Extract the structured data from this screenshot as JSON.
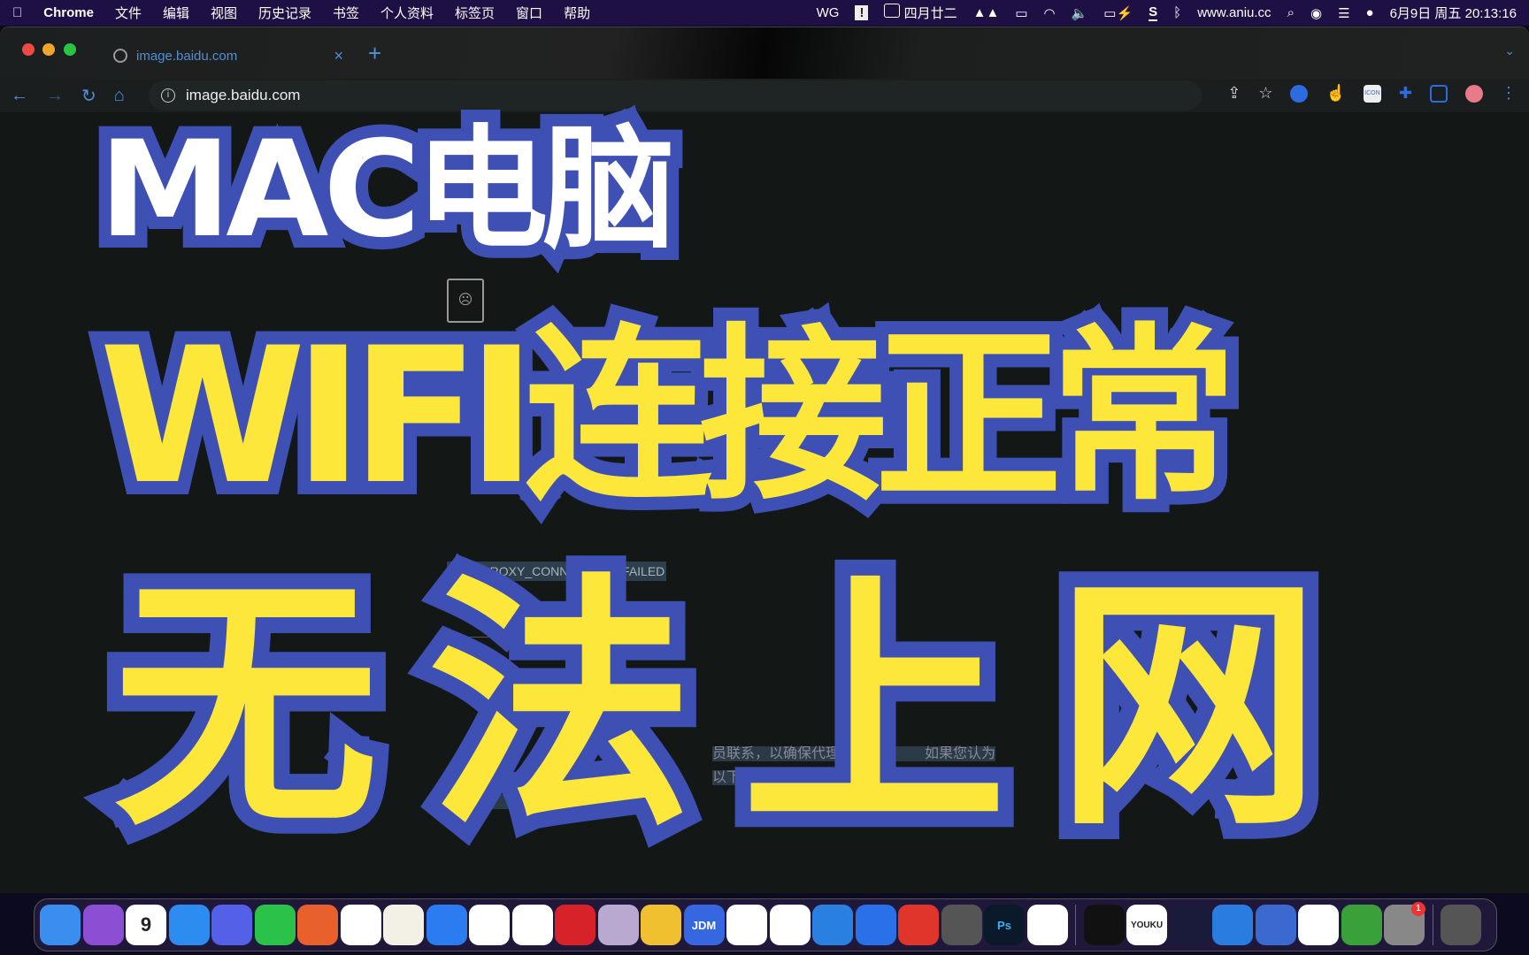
{
  "menubar": {
    "app": "Chrome",
    "items": [
      "文件",
      "编辑",
      "视图",
      "历史记录",
      "书签",
      "个人资料",
      "标签页",
      "窗口",
      "帮助"
    ],
    "wg": "WG",
    "lunar": "四月廿二",
    "site": "www.aniu.cc",
    "datetime": "6月9日 周五 20:13:16"
  },
  "tab": {
    "title": "image.baidu.com",
    "close": "×",
    "new": "+"
  },
  "toolbar": {
    "url": "image.baidu.com",
    "ext_icon_text": "ICON"
  },
  "page": {
    "error_code": "ERR_PROXY_CONNECTION_FAILED",
    "para_line1": "员联系，以确保代理　　　　　　如果您认为",
    "para_line2": "以下操作：依次转到“　　　　　　　理”>“网络”",
    "para_line3": ">“高　　　　　　　　　选的代理。"
  },
  "overlay": {
    "line1": "MAC电脑",
    "line2": "WIFI连接正常",
    "line3": "无法上网"
  },
  "dock": {
    "calendar_month": "6月",
    "calendar_day": "9",
    "jdm": "JDM",
    "ps": "Ps",
    "youku": "YOUKU",
    "badge": "1",
    "apps": [
      "finder",
      "downloads",
      "calendar",
      "safari",
      "quark",
      "wechat",
      "firefox",
      "baidu-netdisk",
      "textedit",
      "feishu",
      "qq",
      "wps-mark",
      "netease-music",
      "launchpad",
      "photos",
      "jdm",
      "wps",
      "moa",
      "app-bird",
      "app-ox",
      "xmind",
      "calculator",
      "photoshop",
      "chrome",
      "terminal",
      "youku",
      "ai-app",
      "lanxin",
      "remote-desktop",
      "ticktick",
      "cleanmaster",
      "system-settings",
      "trash"
    ]
  },
  "colors": {
    "menubar": "#1e0f44",
    "accent": "#4f8fd9",
    "overlay_yellow": "#fde73a",
    "overlay_blue": "#3e50b4"
  }
}
